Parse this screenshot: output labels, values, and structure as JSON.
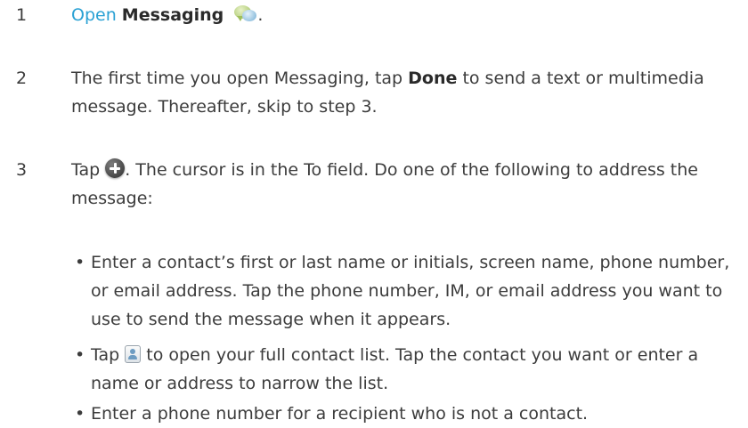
{
  "step1": {
    "number": "1",
    "open_link": "Open",
    "app_name": "Messaging",
    "period": "."
  },
  "step2": {
    "number": "2",
    "before": "The first time you open Messaging, tap ",
    "done": "Done",
    "after": " to send a text or multimedia message. Thereafter, skip to step 3."
  },
  "step3": {
    "number": "3",
    "tap": "Tap ",
    "after": ". The cursor is in the To field. Do one of the following to address the message:"
  },
  "bullets": {
    "symbol": "•",
    "b1": "Enter a contact’s first or last name or initials, screen name, phone number, or email address. Tap the phone number, IM, or email address you want to use to send the message when it appears.",
    "b2_tap": "Tap ",
    "b2_after": " to open your full contact list. Tap the contact you want or enter a name or address to narrow the list.",
    "b3": "Enter a phone number for a recipient who is not a contact."
  },
  "icons": {
    "messaging": "messaging-app-icon",
    "new_message": "new-message-plus-icon",
    "contacts": "contact-list-icon"
  },
  "colors": {
    "link": "#2aa1d4",
    "text": "#3c3c3c"
  }
}
